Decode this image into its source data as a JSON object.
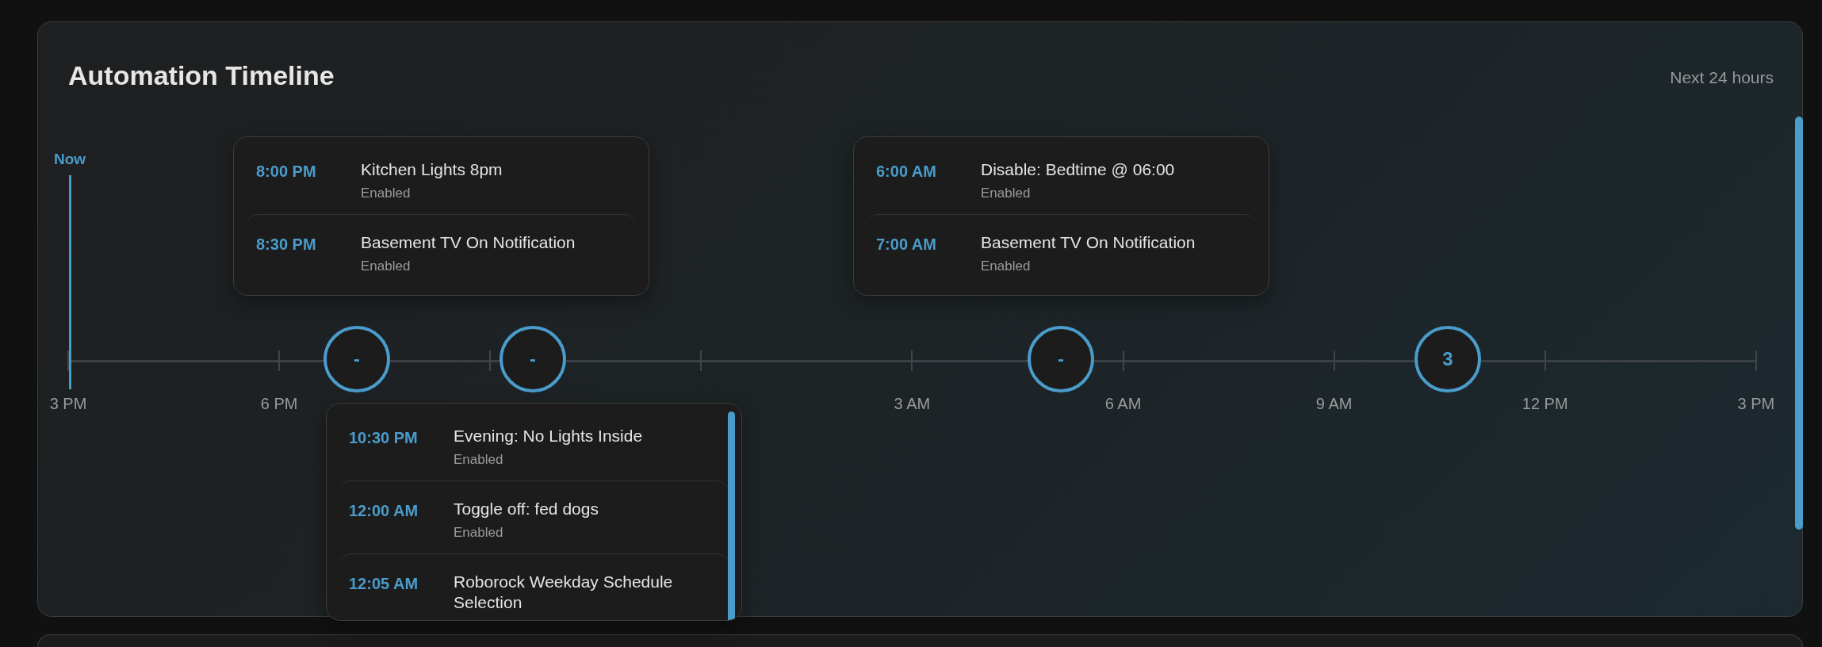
{
  "card": {
    "title": "Automation Timeline",
    "range": "Next 24 hours"
  },
  "now_label": "Now",
  "axis_labels": [
    "3 PM",
    "6 PM",
    "3 AM",
    "6 AM",
    "9 AM",
    "12 PM",
    "3 PM"
  ],
  "markers": [
    {
      "label": "-"
    },
    {
      "label": "-"
    },
    {
      "label": "-"
    },
    {
      "label": "3"
    }
  ],
  "popups": [
    {
      "items": [
        {
          "time": "8:00 PM",
          "name": "Kitchen Lights 8pm",
          "status": "Enabled"
        },
        {
          "time": "8:30 PM",
          "name": "Basement TV On Notification",
          "status": "Enabled"
        }
      ]
    },
    {
      "items": [
        {
          "time": "6:00 AM",
          "name": "Disable: Bedtime @ 06:00",
          "status": "Enabled"
        },
        {
          "time": "7:00 AM",
          "name": "Basement TV On Notification",
          "status": "Enabled"
        }
      ]
    },
    {
      "items": [
        {
          "time": "10:30 PM",
          "name": "Evening: No Lights Inside",
          "status": "Enabled"
        },
        {
          "time": "12:00 AM",
          "name": "Toggle off: fed dogs",
          "status": "Enabled"
        },
        {
          "time": "12:05 AM",
          "name": "Roborock Weekday Schedule Selection"
        }
      ]
    }
  ]
}
